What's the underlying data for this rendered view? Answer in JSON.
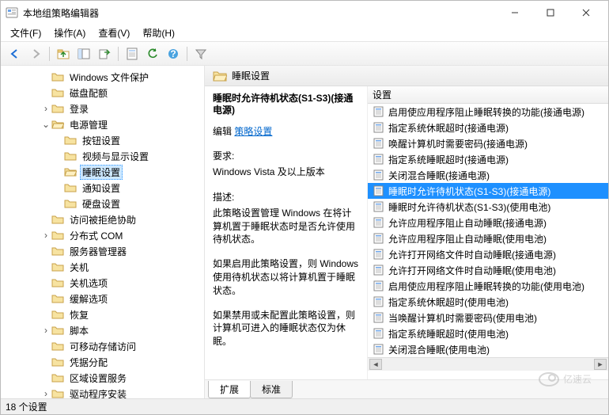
{
  "window": {
    "title": "本地组策略编辑器"
  },
  "menus": [
    {
      "label": "文件(F)"
    },
    {
      "label": "操作(A)"
    },
    {
      "label": "查看(V)"
    },
    {
      "label": "帮助(H)"
    }
  ],
  "tree": [
    {
      "depth": 3,
      "twisty": "",
      "icon": "folder",
      "label": "Windows 文件保护"
    },
    {
      "depth": 3,
      "twisty": "",
      "icon": "folder",
      "label": "磁盘配额"
    },
    {
      "depth": 3,
      "twisty": "›",
      "icon": "folder",
      "label": "登录"
    },
    {
      "depth": 3,
      "twisty": "⌄",
      "icon": "folder-open",
      "label": "电源管理"
    },
    {
      "depth": 4,
      "twisty": "",
      "icon": "folder",
      "label": "按钮设置"
    },
    {
      "depth": 4,
      "twisty": "",
      "icon": "folder",
      "label": "视频与显示设置"
    },
    {
      "depth": 4,
      "twisty": "",
      "icon": "folder-open",
      "label": "睡眠设置",
      "selected": true
    },
    {
      "depth": 4,
      "twisty": "",
      "icon": "folder",
      "label": "通知设置"
    },
    {
      "depth": 4,
      "twisty": "",
      "icon": "folder",
      "label": "硬盘设置"
    },
    {
      "depth": 3,
      "twisty": "",
      "icon": "folder",
      "label": "访问被拒绝协助"
    },
    {
      "depth": 3,
      "twisty": "›",
      "icon": "folder",
      "label": "分布式 COM"
    },
    {
      "depth": 3,
      "twisty": "",
      "icon": "folder",
      "label": "服务器管理器"
    },
    {
      "depth": 3,
      "twisty": "",
      "icon": "folder",
      "label": "关机"
    },
    {
      "depth": 3,
      "twisty": "",
      "icon": "folder",
      "label": "关机选项"
    },
    {
      "depth": 3,
      "twisty": "",
      "icon": "folder",
      "label": "缓解选项"
    },
    {
      "depth": 3,
      "twisty": "",
      "icon": "folder",
      "label": "恢复"
    },
    {
      "depth": 3,
      "twisty": "›",
      "icon": "folder",
      "label": "脚本"
    },
    {
      "depth": 3,
      "twisty": "",
      "icon": "folder",
      "label": "可移动存储访问"
    },
    {
      "depth": 3,
      "twisty": "",
      "icon": "folder",
      "label": "凭据分配"
    },
    {
      "depth": 3,
      "twisty": "",
      "icon": "folder",
      "label": "区域设置服务"
    },
    {
      "depth": 3,
      "twisty": "›",
      "icon": "folder",
      "label": "驱动程序安装"
    }
  ],
  "right_header": {
    "title": "睡眠设置"
  },
  "info": {
    "title": "睡眠时允许待机状态(S1-S3)(接通电源)",
    "edit_prefix": "编辑",
    "edit_link": "策略设置",
    "req_label": "要求:",
    "req_value": "Windows Vista 及以上版本",
    "desc_label": "描述:",
    "desc_p1": "此策略设置管理 Windows 在将计算机置于睡眠状态时是否允许使用待机状态。",
    "desc_p2": "如果启用此策略设置，则 Windows 使用待机状态以将计算机置于睡眠状态。",
    "desc_p3": "如果禁用或未配置此策略设置，则计算机可进入的睡眠状态仅为休眠。"
  },
  "list_header": "设置",
  "list": [
    {
      "label": "启用使应用程序阻止睡眠转换的功能(接通电源)"
    },
    {
      "label": "指定系统休眠超时(接通电源)"
    },
    {
      "label": "唤醒计算机时需要密码(接通电源)"
    },
    {
      "label": "指定系统睡眠超时(接通电源)"
    },
    {
      "label": "关闭混合睡眠(接通电源)"
    },
    {
      "label": "睡眠时允许待机状态(S1-S3)(接通电源)",
      "selected": true
    },
    {
      "label": "睡眠时允许待机状态(S1-S3)(使用电池)"
    },
    {
      "label": "允许应用程序阻止自动睡眠(接通电源)"
    },
    {
      "label": "允许应用程序阻止自动睡眠(使用电池)"
    },
    {
      "label": "允许打开网络文件时自动睡眠(接通电源)"
    },
    {
      "label": "允许打开网络文件时自动睡眠(使用电池)"
    },
    {
      "label": "启用使应用程序阻止睡眠转换的功能(使用电池)"
    },
    {
      "label": "指定系统休眠超时(使用电池)"
    },
    {
      "label": "当唤醒计算机时需要密码(使用电池)"
    },
    {
      "label": "指定系统睡眠超时(使用电池)"
    },
    {
      "label": "关闭混合睡眠(使用电池)"
    }
  ],
  "tabs": [
    {
      "label": "扩展",
      "active": true
    },
    {
      "label": "标准",
      "active": false
    }
  ],
  "status": "18 个设置",
  "watermark": "亿速云"
}
